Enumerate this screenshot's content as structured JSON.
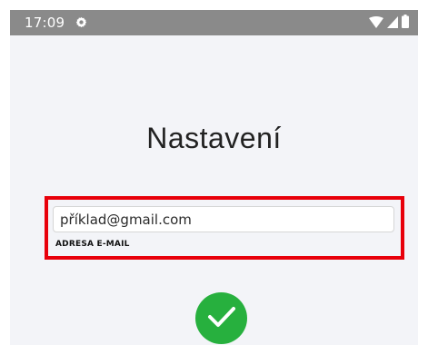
{
  "status_bar": {
    "time": "17:09",
    "settings_icon": "gear-icon",
    "wifi_icon": "wifi-icon",
    "signal_icon": "signal-icon",
    "battery_icon": "battery-icon"
  },
  "page": {
    "title": "Nastavení"
  },
  "form": {
    "email_value": "příklad@gmail.com",
    "email_label": "ADRESA E-MAIL"
  },
  "confirm": {
    "icon": "checkmark-icon"
  },
  "colors": {
    "status_bar_bg": "#8a8a8a",
    "screen_bg": "#f3f4f8",
    "highlight_border": "#e8000b",
    "confirm_button": "#27b03e"
  }
}
